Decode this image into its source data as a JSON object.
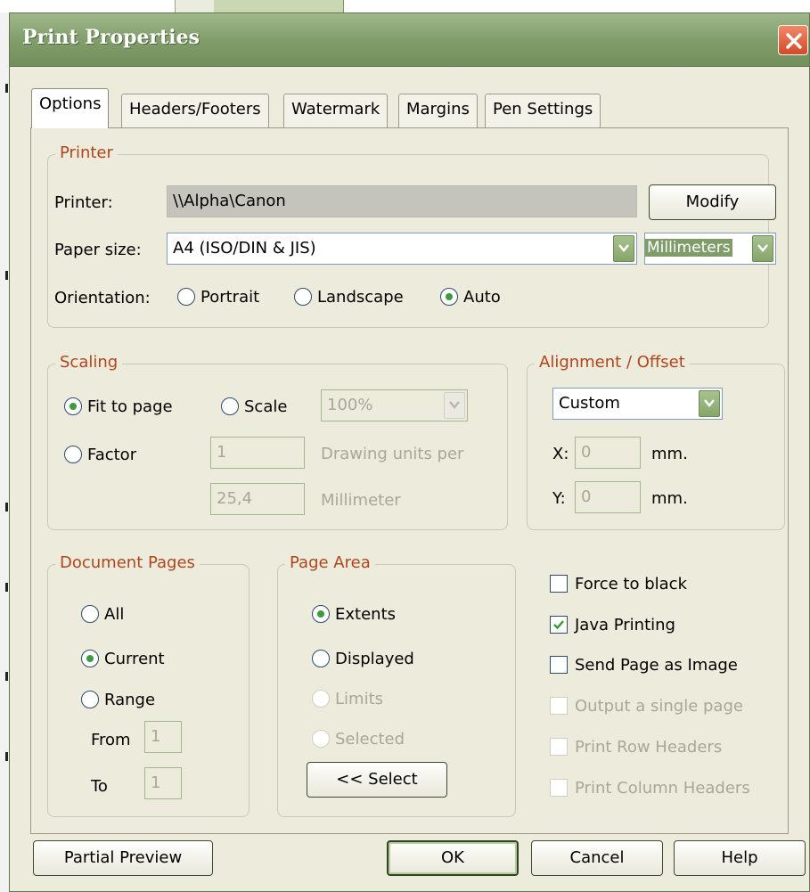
{
  "window": {
    "title": "Print Properties"
  },
  "tabs": [
    "Options",
    "Headers/Footers",
    "Watermark",
    "Margins",
    "Pen Settings"
  ],
  "printer_group": {
    "title": "Printer",
    "printer_label": "Printer:",
    "printer_value": "\\\\Alpha\\Canon",
    "modify_label": "Modify",
    "paper_size_label": "Paper size:",
    "paper_size_value": "A4 (ISO/DIN & JIS)",
    "units_value": "Millimeters",
    "orientation_label": "Orientation:",
    "orientation_options": [
      "Portrait",
      "Landscape",
      "Auto"
    ],
    "orientation_selected": "Auto"
  },
  "scaling": {
    "title": "Scaling",
    "fit_to_page_label": "Fit to page",
    "scale_label": "Scale",
    "scale_value": "100%",
    "factor_label": "Factor",
    "factor_value_1": "1",
    "factor_value_2": "25,4",
    "drawing_units_label": "Drawing units per",
    "millimeter_label": "Millimeter",
    "selected": "Fit to page"
  },
  "alignment": {
    "title": "Alignment / Offset",
    "mode_value": "Custom",
    "x_label": "X:",
    "x_value": "0",
    "y_label": "Y:",
    "y_value": "0",
    "unit_label": "mm."
  },
  "document_pages": {
    "title": "Document Pages",
    "all_label": "All",
    "current_label": "Current",
    "range_label": "Range",
    "from_label": "From",
    "from_value": "1",
    "to_label": "To",
    "to_value": "1",
    "selected": "Current"
  },
  "page_area": {
    "title": "Page Area",
    "extents_label": "Extents",
    "displayed_label": "Displayed",
    "limits_label": "Limits",
    "selected_label": "Selected",
    "select_button_label": "<< Select",
    "selected": "Extents"
  },
  "options": {
    "force_black_label": "Force to black",
    "force_black_checked": false,
    "java_printing_label": "Java Printing",
    "java_printing_checked": true,
    "send_image_label": "Send Page as Image",
    "send_image_checked": false,
    "single_page_label": "Output a single page",
    "row_headers_label": "Print Row Headers",
    "column_headers_label": "Print Column Headers"
  },
  "footer": {
    "partial_preview_label": "Partial Preview",
    "ok_label": "OK",
    "cancel_label": "Cancel",
    "help_label": "Help"
  },
  "colors": {
    "titlebar": "#7f9c69",
    "group_title": "#b0451d",
    "dialog_bg": "#ecebdc",
    "radio_dot": "#3f9b3f"
  }
}
